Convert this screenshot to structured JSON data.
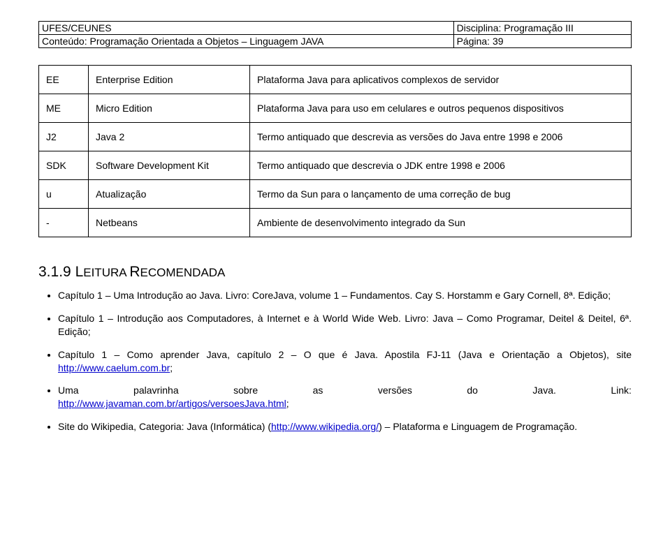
{
  "header": {
    "row1_left": "UFES/CEUNES",
    "row1_right": "Disciplina: Programação III",
    "row2_left": "Conteúdo: Programação Orientada a Objetos – Linguagem JAVA",
    "row2_right": "Página: 39"
  },
  "table": {
    "rows": [
      {
        "c0": "EE",
        "c1": "Enterprise Edition",
        "c2": "Plataforma Java para aplicativos complexos de servidor"
      },
      {
        "c0": "ME",
        "c1": "Micro Edition",
        "c2": "Plataforma Java para uso em celulares e outros pequenos dispositivos"
      },
      {
        "c0": "J2",
        "c1": "Java 2",
        "c2": "Termo antiquado que descrevia as versões do Java entre 1998 e 2006"
      },
      {
        "c0": "SDK",
        "c1": "Software Development Kit",
        "c2": "Termo antiquado que descrevia o JDK entre 1998 e 2006"
      },
      {
        "c0": "u",
        "c1": "Atualização",
        "c2": "Termo da Sun para o lançamento de uma correção de bug"
      },
      {
        "c0": "-",
        "c1": "Netbeans",
        "c2": "Ambiente de desenvolvimento integrado da Sun"
      }
    ]
  },
  "section": {
    "number": "3.1.9",
    "title_word1": "L",
    "title_rest1": "EITURA ",
    "title_word2": "R",
    "title_rest2": "ECOMENDADA"
  },
  "bullets": {
    "b1": "Capítulo 1 – Uma Introdução ao Java. Livro: CoreJava, volume 1 – Fundamentos. Cay S. Horstamm e Gary Cornell, 8ª. Edição;",
    "b2": "Capítulo 1 – Introdução aos Computadores, à Internet e à World Wide Web. Livro: Java – Como Programar, Deitel & Deitel, 6ª. Edição;",
    "b3_pre": "Capítulo 1 – Como aprender Java, capítulo 2 – O que é Java. Apostila FJ-11 (Java e Orientação a Objetos), site ",
    "b3_link": "http://www.caelum.com.br",
    "b3_post": ";",
    "b4_w1": "Uma",
    "b4_w2": "palavrinha",
    "b4_w3": "sobre",
    "b4_w4": "as",
    "b4_w5": "versões",
    "b4_w6": "do",
    "b4_w7": "Java.",
    "b4_w8": "Link:",
    "b4_link": "http://www.javaman.com.br/artigos/versoesJava.html",
    "b4_post": ";",
    "b5_pre": "Site do Wikipedia, Categoria: Java (Informática) (",
    "b5_link": "http://www.wikipedia.org/",
    "b5_post": ") – Plataforma e Linguagem de Programação."
  }
}
